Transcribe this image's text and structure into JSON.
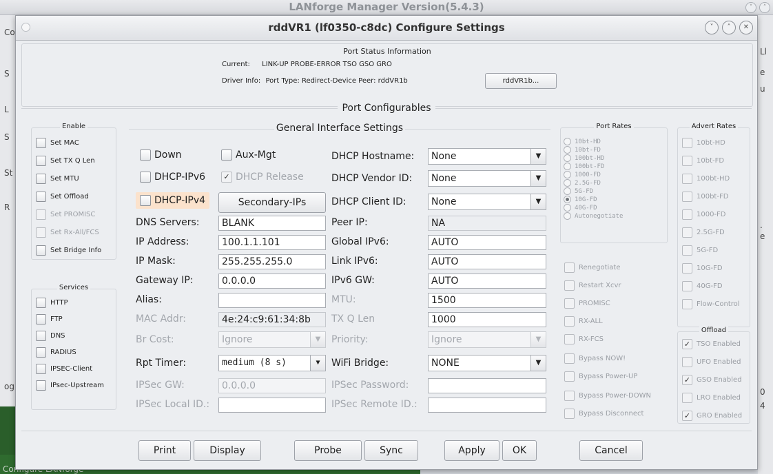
{
  "background": {
    "title": "LANforge Manager   Version(5.4.3)",
    "left_letters": [
      "Co",
      "S",
      "L",
      "S",
      "St",
      "R",
      "og"
    ],
    "right_letters": [
      "Ll",
      "e",
      "u",
      ".",
      "e",
      "0",
      "4"
    ],
    "status": "Configure LANforge"
  },
  "dialog": {
    "title": "rddVR1  (lf0350-c8dc) Configure Settings",
    "window_controls": [
      "˅",
      "˄",
      "✕"
    ]
  },
  "status_panel": {
    "heading": "Port Status Information",
    "current_label": "Current:",
    "current_value": "LINK-UP PROBE-ERROR TSO GSO GRO",
    "driver_label": "Driver Info:",
    "driver_value": "Port Type: Redirect-Device   Peer: rddVR1b",
    "peer_button": "rddVR1b..."
  },
  "port_configurables": {
    "heading": "Port Configurables"
  },
  "enable": {
    "legend": "Enable",
    "items": [
      {
        "label": "Set MAC",
        "enabled": true
      },
      {
        "label": "Set TX Q Len",
        "enabled": true
      },
      {
        "label": "Set MTU",
        "enabled": true
      },
      {
        "label": "Set Offload",
        "enabled": true
      },
      {
        "label": "Set PROMISC",
        "enabled": false
      },
      {
        "label": "Set Rx-All/FCS",
        "enabled": false
      },
      {
        "label": "Set Bridge Info",
        "enabled": true
      }
    ]
  },
  "services": {
    "legend": "Services",
    "items": [
      "HTTP",
      "FTP",
      "DNS",
      "RADIUS",
      "IPSEC-Client",
      "IPsec-Upstream"
    ]
  },
  "general": {
    "legend": "General Interface Settings",
    "down": "Down",
    "aux_mgt": "Aux-Mgt",
    "dhcp_ipv6": "DHCP-IPv6",
    "dhcp_release": "DHCP Release",
    "dhcp_ipv4": "DHCP-IPv4",
    "secondary_ips": "Secondary-IPs",
    "dhcp_hostname_label": "DHCP Hostname:",
    "dhcp_hostname": "None",
    "dhcp_vendor_label": "DHCP Vendor ID:",
    "dhcp_vendor": "None",
    "dhcp_client_label": "DHCP Client ID:",
    "dhcp_client": "None",
    "dns_label": "DNS Servers:",
    "dns": "BLANK",
    "peer_ip_label": "Peer IP:",
    "peer_ip": "NA",
    "ip_label": "IP Address:",
    "ip": "100.1.1.101",
    "global_ipv6_label": "Global IPv6:",
    "global_ipv6": "AUTO",
    "mask_label": "IP Mask:",
    "mask": "255.255.255.0",
    "link_ipv6_label": "Link IPv6:",
    "link_ipv6": "AUTO",
    "gw_label": "Gateway IP:",
    "gw": "0.0.0.0",
    "ipv6_gw_label": "IPv6 GW:",
    "ipv6_gw": "AUTO",
    "alias_label": "Alias:",
    "alias": "",
    "mtu_label": "MTU:",
    "mtu": "1500",
    "mac_label": "MAC Addr:",
    "mac": "4e:24:c9:61:34:8b",
    "txq_label": "TX Q Len",
    "txq": "1000",
    "brcost_label": "Br Cost:",
    "brcost": "Ignore",
    "priority_label": "Priority:",
    "priority": "Ignore",
    "rpt_label": "Rpt Timer:",
    "rpt": "medium  (8 s)",
    "wifi_bridge_label": "WiFi Bridge:",
    "wifi_bridge": "NONE",
    "ipsec_gw_label": "IPSec GW:",
    "ipsec_gw": "0.0.0.0",
    "ipsec_pw_label": "IPSec Password:",
    "ipsec_pw": "",
    "ipsec_local_label": "IPSec Local ID.:",
    "ipsec_local": "",
    "ipsec_remote_label": "IPSec Remote ID.:",
    "ipsec_remote": ""
  },
  "port_rates": {
    "legend": "Port Rates",
    "items": [
      "10bt-HD",
      "10bt-FD",
      "100bt-HD",
      "100bt-FD",
      "1000-FD",
      "2.5G-FD",
      "5G-FD",
      "10G-FD",
      "40G-FD",
      "Autonegotiate"
    ],
    "selected": "10G-FD"
  },
  "advert_rates": {
    "legend": "Advert Rates",
    "items": [
      "10bt-HD",
      "10bt-FD",
      "100bt-HD",
      "100bt-FD",
      "1000-FD",
      "2.5G-FD",
      "5G-FD",
      "10G-FD",
      "40G-FD",
      "Flow-Control"
    ]
  },
  "misc_options": [
    "Renegotiate",
    "Restart Xcvr",
    "PROMISC",
    "RX-ALL",
    "RX-FCS",
    "Bypass NOW!",
    "Bypass Power-UP",
    "Bypass Power-DOWN",
    "Bypass Disconnect"
  ],
  "offload": {
    "legend": "Offload",
    "items": [
      {
        "label": "TSO Enabled",
        "checked": true
      },
      {
        "label": "UFO Enabled",
        "checked": false
      },
      {
        "label": "GSO Enabled",
        "checked": true
      },
      {
        "label": "LRO Enabled",
        "checked": false
      },
      {
        "label": "GRO Enabled",
        "checked": true
      }
    ]
  },
  "buttons": {
    "print": "Print",
    "display": "Display",
    "probe": "Probe",
    "sync": "Sync",
    "apply": "Apply",
    "ok": "OK",
    "cancel": "Cancel"
  }
}
